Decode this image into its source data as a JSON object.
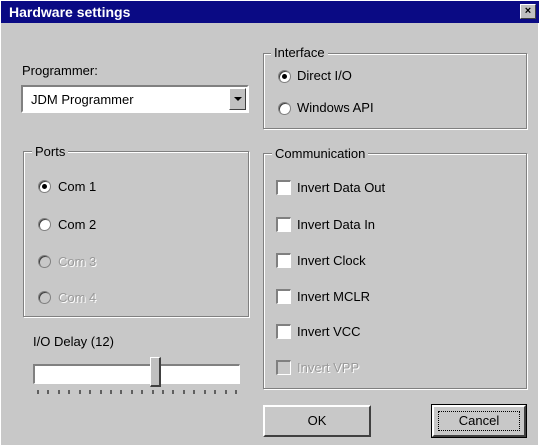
{
  "window": {
    "title": "Hardware settings",
    "close_glyph": "×"
  },
  "programmer": {
    "label": "Programmer:",
    "selected": "JDM Programmer"
  },
  "interface": {
    "title": "Interface",
    "options": [
      {
        "label": "Direct I/O",
        "selected": true
      },
      {
        "label": "Windows API",
        "selected": false
      }
    ]
  },
  "ports": {
    "title": "Ports",
    "options": [
      {
        "label": "Com 1",
        "selected": true,
        "enabled": true
      },
      {
        "label": "Com 2",
        "selected": false,
        "enabled": true
      },
      {
        "label": "Com 3",
        "selected": false,
        "enabled": false
      },
      {
        "label": "Com 4",
        "selected": false,
        "enabled": false
      }
    ]
  },
  "communication": {
    "title": "Communication",
    "options": [
      {
        "label": "Invert Data Out",
        "checked": false,
        "enabled": true
      },
      {
        "label": "Invert Data In",
        "checked": false,
        "enabled": true
      },
      {
        "label": "Invert Clock",
        "checked": false,
        "enabled": true
      },
      {
        "label": "Invert MCLR",
        "checked": false,
        "enabled": true
      },
      {
        "label": "Invert VCC",
        "checked": false,
        "enabled": true
      },
      {
        "label": "Invert VPP",
        "checked": false,
        "enabled": false
      }
    ]
  },
  "io_delay": {
    "label": "I/O Delay (12)",
    "value": 12,
    "tick_count": 20
  },
  "buttons": {
    "ok": "OK",
    "cancel": "Cancel"
  },
  "colors": {
    "titlebar": "#0a0a84",
    "face": "#c8c8c8"
  }
}
